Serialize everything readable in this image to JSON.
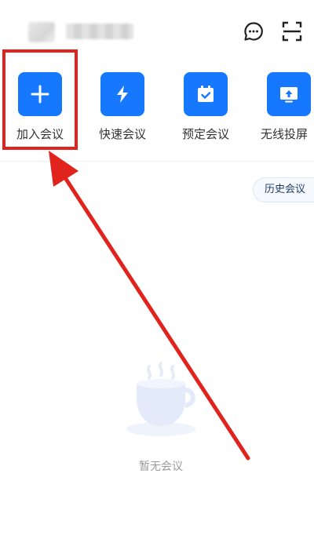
{
  "header": {
    "chat_icon": "message-bubble-icon",
    "scan_icon": "scan-icon"
  },
  "actions": [
    {
      "label": "加入会议",
      "icon": "plus-icon"
    },
    {
      "label": "快速会议",
      "icon": "lightning-icon"
    },
    {
      "label": "预定会议",
      "icon": "calendar-check-icon"
    },
    {
      "label": "无线投屏",
      "icon": "screen-cast-icon"
    }
  ],
  "history_button": {
    "label": "历史会议"
  },
  "empty_state": {
    "text": "暂无会议",
    "icon": "coffee-cup-icon"
  },
  "colors": {
    "accent": "#1677ff",
    "annotation": "#e0231c"
  }
}
